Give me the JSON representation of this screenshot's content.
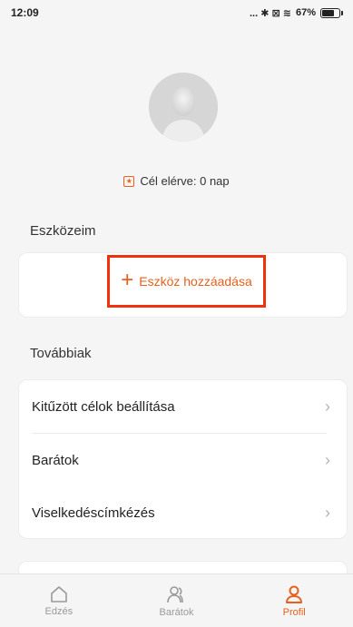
{
  "status": {
    "time": "12:09",
    "indicators": "... ✱ ⊠ ≋",
    "battery": "67%"
  },
  "profile": {
    "goal_text": "Cél elérve: 0 nap"
  },
  "devices": {
    "section_title": "Eszközeim",
    "add_label": "Eszköz hozzáadása"
  },
  "more": {
    "section_title": "Továbbiak",
    "items": [
      {
        "label": "Kitűzött célok beállítása"
      },
      {
        "label": "Barátok"
      },
      {
        "label": "Viselkedéscímkézés"
      }
    ]
  },
  "tabs": [
    {
      "label": "Edzés",
      "icon": "home-icon"
    },
    {
      "label": "Barátok",
      "icon": "friends-icon"
    },
    {
      "label": "Profil",
      "icon": "person-icon",
      "active": true
    }
  ],
  "colors": {
    "accent": "#e8601c",
    "highlight": "#f0300e"
  }
}
